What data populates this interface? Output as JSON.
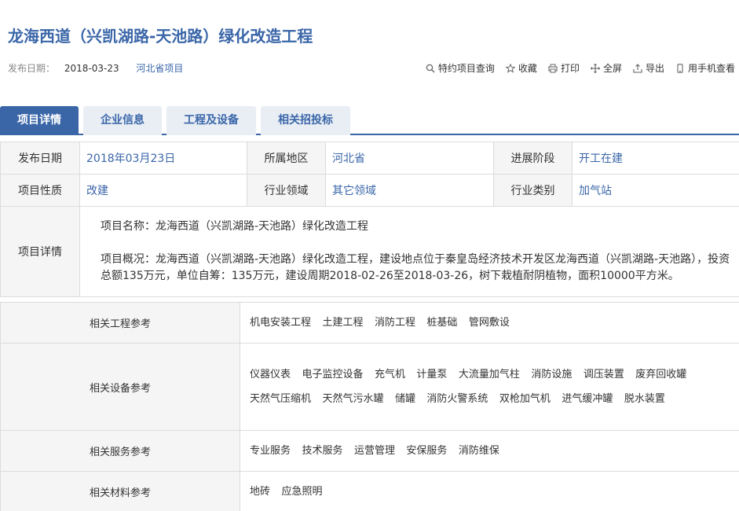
{
  "header": {
    "title": "龙海西道（兴凯湖路-天池路）绿化改造工程",
    "publish_label": "发布日期：",
    "publish_date": "2018-03-23",
    "region_link": "河北省项目"
  },
  "toolbar": [
    {
      "label": "特约项目查询",
      "icon": "search-icon"
    },
    {
      "label": "收藏",
      "icon": "star-icon"
    },
    {
      "label": "打印",
      "icon": "printer-icon"
    },
    {
      "label": "全屏",
      "icon": "fullscreen-icon"
    },
    {
      "label": "导出",
      "icon": "export-icon"
    },
    {
      "label": "用手机查看",
      "icon": "mobile-icon"
    }
  ],
  "tabs": [
    "项目详情",
    "企业信息",
    "工程及设备",
    "相关招投标"
  ],
  "info": {
    "row1": [
      {
        "key": "发布日期",
        "value": "2018年03月23日"
      },
      {
        "key": "所属地区",
        "value": "河北省"
      },
      {
        "key": "进展阶段",
        "value": "开工在建"
      }
    ],
    "row2": [
      {
        "key": "项目性质",
        "value": "改建"
      },
      {
        "key": "行业领域",
        "value": "其它领域"
      },
      {
        "key": "行业类别",
        "value": "加气站"
      }
    ],
    "detail_key": "项目详情",
    "detail_name": "项目名称：龙海西道（兴凯湖路-天池路）绿化改造工程",
    "detail_summary": "项目概况：龙海西道（兴凯湖路-天池路）绿化改造工程，建设地点位于秦皇岛经济技术开发区龙海西道（兴凯湖路-天池路），投资总额135万元，单位自筹：135万元，建设周期2018-02-26至2018-03-26，树下栽植耐阴植物，面积10000平方米。"
  },
  "related": {
    "engineering": {
      "label": "相关工程参考",
      "items": [
        "机电安装工程",
        "土建工程",
        "消防工程",
        "桩基础",
        "管网敷设"
      ]
    },
    "equipment": {
      "label": "相关设备参考",
      "items": [
        "仪器仪表",
        "电子监控设备",
        "充气机",
        "计量泵",
        "大流量加气柱",
        "消防设施",
        "调压装置",
        "废弃回收罐",
        "天然气压缩机",
        "天然气污水罐",
        "储罐",
        "消防火警系统",
        "双枪加气机",
        "进气缓冲罐",
        "脱水装置"
      ]
    },
    "services": {
      "label": "相关服务参考",
      "items": [
        "专业服务",
        "技术服务",
        "运营管理",
        "安保服务",
        "消防维保"
      ]
    },
    "materials": {
      "label": "相关材料参考",
      "items": [
        "地砖",
        "应急照明"
      ]
    }
  }
}
